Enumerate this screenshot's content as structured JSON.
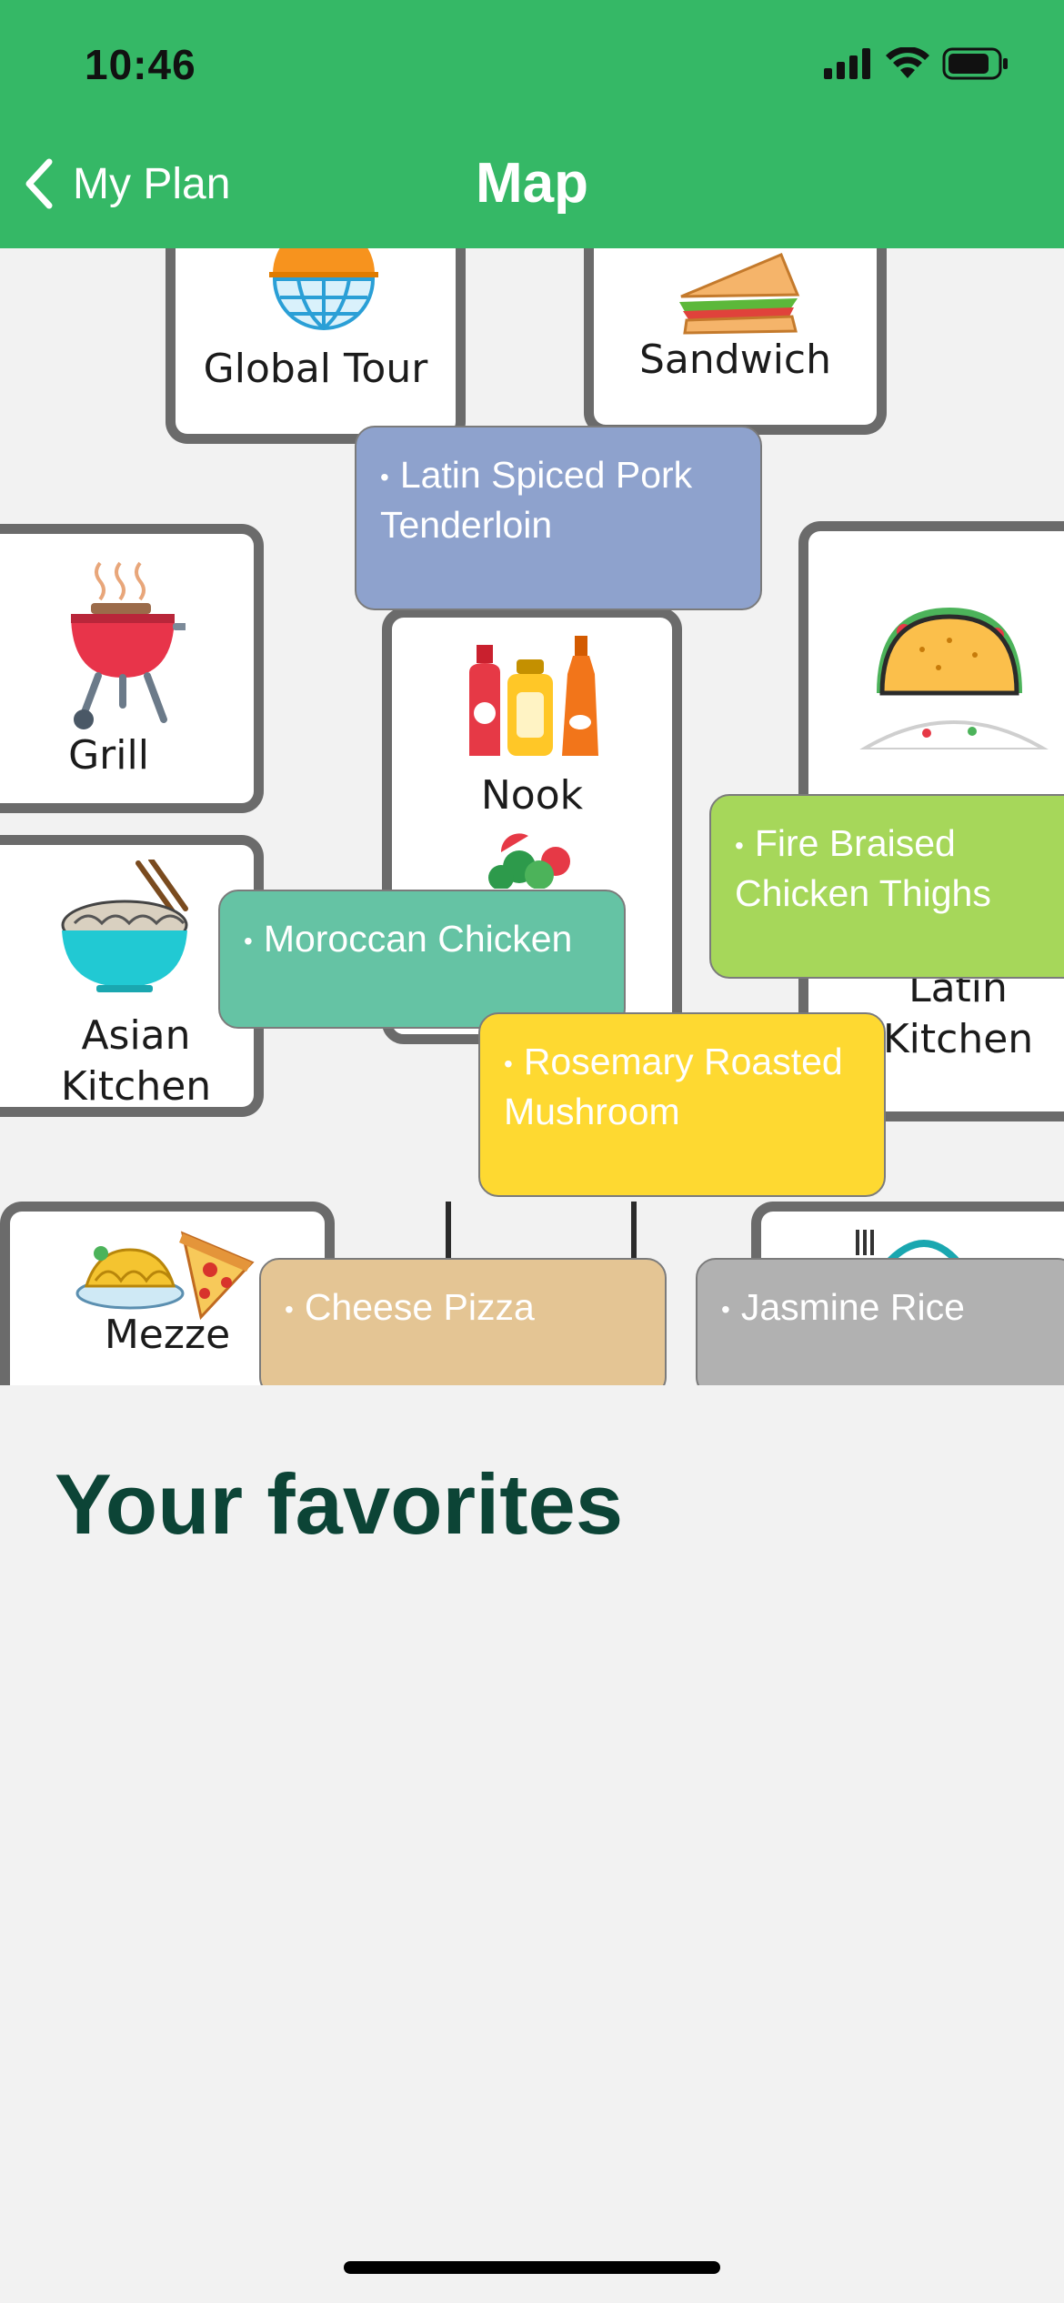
{
  "status": {
    "time": "10:46"
  },
  "nav": {
    "back_label": "My Plan",
    "title": "Map"
  },
  "stations": {
    "global_tour": "Global Tour",
    "sandwich": "Sandwich",
    "grill": "Grill",
    "nook": "Nook",
    "asian_kitchen": "Asian\nKitchen",
    "latin_kitchen": "Latin\nKitchen",
    "mezze": "Mezze"
  },
  "dishes": [
    {
      "label": "Latin Spiced Pork Tenderloin",
      "color": "#8ea2cd"
    },
    {
      "label": "Fire Braised Chicken Thighs",
      "color": "#a6d75a"
    },
    {
      "label": "Moroccan Chicken",
      "color": "#65c3a4"
    },
    {
      "label": "Rosemary Roasted Mushroom",
      "color": "#fed931"
    },
    {
      "label": "Cheese Pizza",
      "color": "#e4c594"
    },
    {
      "label": "Jasmine Rice",
      "color": "#b1b1b1"
    }
  ],
  "favorites": {
    "title": "Your favorites"
  }
}
